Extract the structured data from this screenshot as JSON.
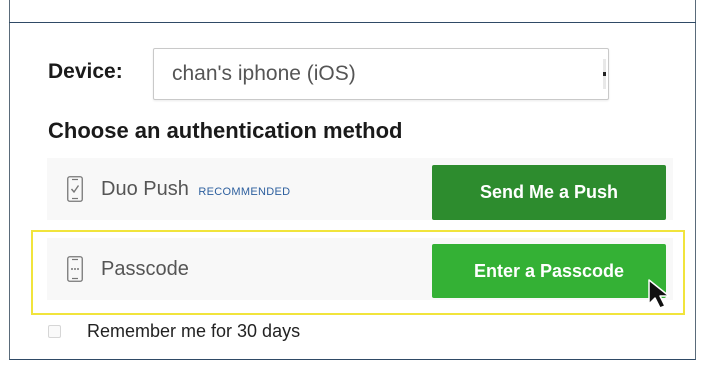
{
  "device": {
    "label": "Device:",
    "selected": "chan's iphone (iOS)"
  },
  "heading": "Choose an authentication method",
  "methods": [
    {
      "label": "Duo Push",
      "badge": "RECOMMENDED",
      "button": "Send Me a Push",
      "icon": "phone-check-icon"
    },
    {
      "label": "Passcode",
      "badge": "",
      "button": "Enter a Passcode",
      "icon": "phone-dots-icon"
    }
  ],
  "remember": {
    "label": "Remember me for 30 days",
    "checked": false
  },
  "colors": {
    "push_button": "#2d8c2e",
    "passcode_button": "#34b135",
    "highlight": "#f1e43c",
    "recommended_text": "#2d5f9e"
  }
}
